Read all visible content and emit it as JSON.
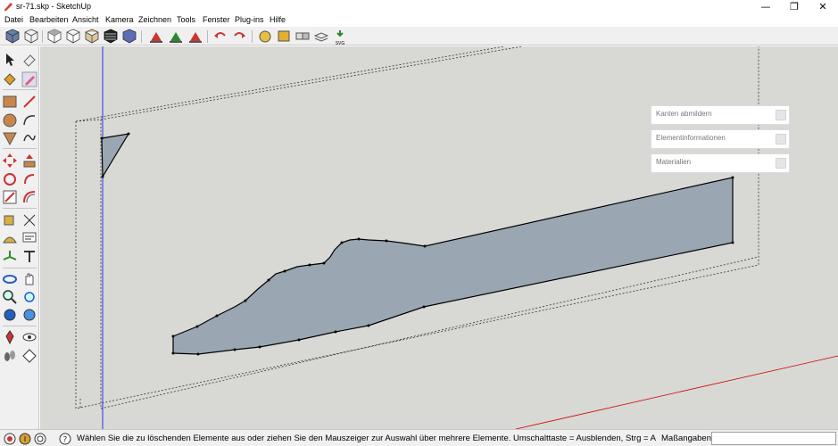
{
  "window": {
    "title": "sr-71.skp - SketchUp",
    "minimize_glyph": "—",
    "maximize_glyph": "❐",
    "close_glyph": "✕"
  },
  "menu": [
    "Datei",
    "Bearbeiten",
    "Ansicht",
    "Kamera",
    "Zeichnen",
    "Tools",
    "Fenster",
    "Plug-ins",
    "Hilfe"
  ],
  "toolbar": {
    "icons": [
      "iso-view-icon",
      "wireframe-box-icon",
      "top-view-icon",
      "front-view-icon",
      "right-view-icon",
      "back-view-icon",
      "left-view-icon",
      "xray-icon",
      "hidden-line-icon",
      "shaded-icon",
      "shaded-textures-icon",
      "monochrome-icon",
      "export-j-icon",
      "export-v-icon",
      "export-n-icon",
      "undo-icon",
      "redo-icon",
      "sandbox-icon",
      "extension-warehouse-icon",
      "components-icon",
      "layers-icon",
      "export-svg-icon"
    ],
    "svg_label": "SVG"
  },
  "left_tools": [
    "select-icon",
    "eraser-icon",
    "paint-bucket-icon",
    "pencil-icon",
    "rectangle-icon",
    "line-icon",
    "circle-icon",
    "arc-icon",
    "polygon-icon",
    "freehand-icon",
    "move-icon",
    "push-pull-icon",
    "rotate-icon",
    "follow-me-icon",
    "scale-icon",
    "offset-icon",
    "tape-measure-icon",
    "dimension-icon",
    "protractor-icon",
    "text-icon",
    "axes-icon",
    "3d-text-icon",
    "orbit-icon",
    "pan-icon",
    "zoom-icon",
    "zoom-window-icon",
    "zoom-extents-icon",
    "previous-view-icon",
    "position-camera-icon",
    "look-around-icon",
    "walk-icon",
    "section-plane-icon"
  ],
  "trays": [
    {
      "label": "Kanten abmildern"
    },
    {
      "label": "Elementinformationen"
    },
    {
      "label": "Materialien"
    }
  ],
  "status": {
    "text": "Wählen Sie die zu löschenden Elemente aus oder ziehen Sie den Mauszeiger zur Auswahl über mehrere Elemente. Umschalttaste = Ausblenden, Strg = A",
    "measurements_label": "Maßangaben",
    "measurements_value": ""
  },
  "colors": {
    "face": "#9aa6b2",
    "background": "#d8d8d4",
    "axis_blue": "#0000ff",
    "axis_red": "#cc0000"
  }
}
